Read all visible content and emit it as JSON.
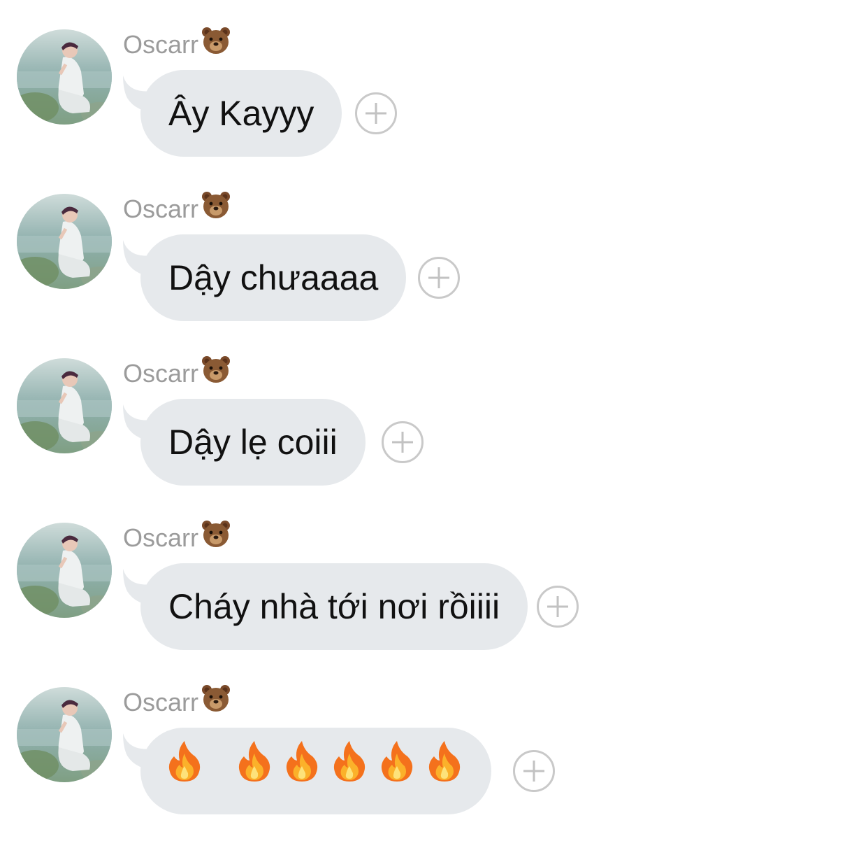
{
  "chat": {
    "messages": [
      {
        "sender": "Oscarr",
        "sender_emoji": "bear-face",
        "text": "Ây Kayyy"
      },
      {
        "sender": "Oscarr",
        "sender_emoji": "bear-face",
        "text": "Dậy chưaaaa"
      },
      {
        "sender": "Oscarr",
        "sender_emoji": "bear-face",
        "text": "Dậy lẹ coiii"
      },
      {
        "sender": "Oscarr",
        "sender_emoji": "bear-face",
        "text": "Cháy nhà tới nơi rồiiii"
      },
      {
        "sender": "Oscarr",
        "sender_emoji": "bear-face",
        "emoji_message": [
          "fire",
          "fire",
          "fire",
          "fire",
          "fire",
          "fire"
        ]
      }
    ]
  },
  "colors": {
    "bubble": "#e6e9ec",
    "sender_name": "#9b9b9b",
    "message_text": "#111111",
    "add_button": "#c9c9c9"
  }
}
